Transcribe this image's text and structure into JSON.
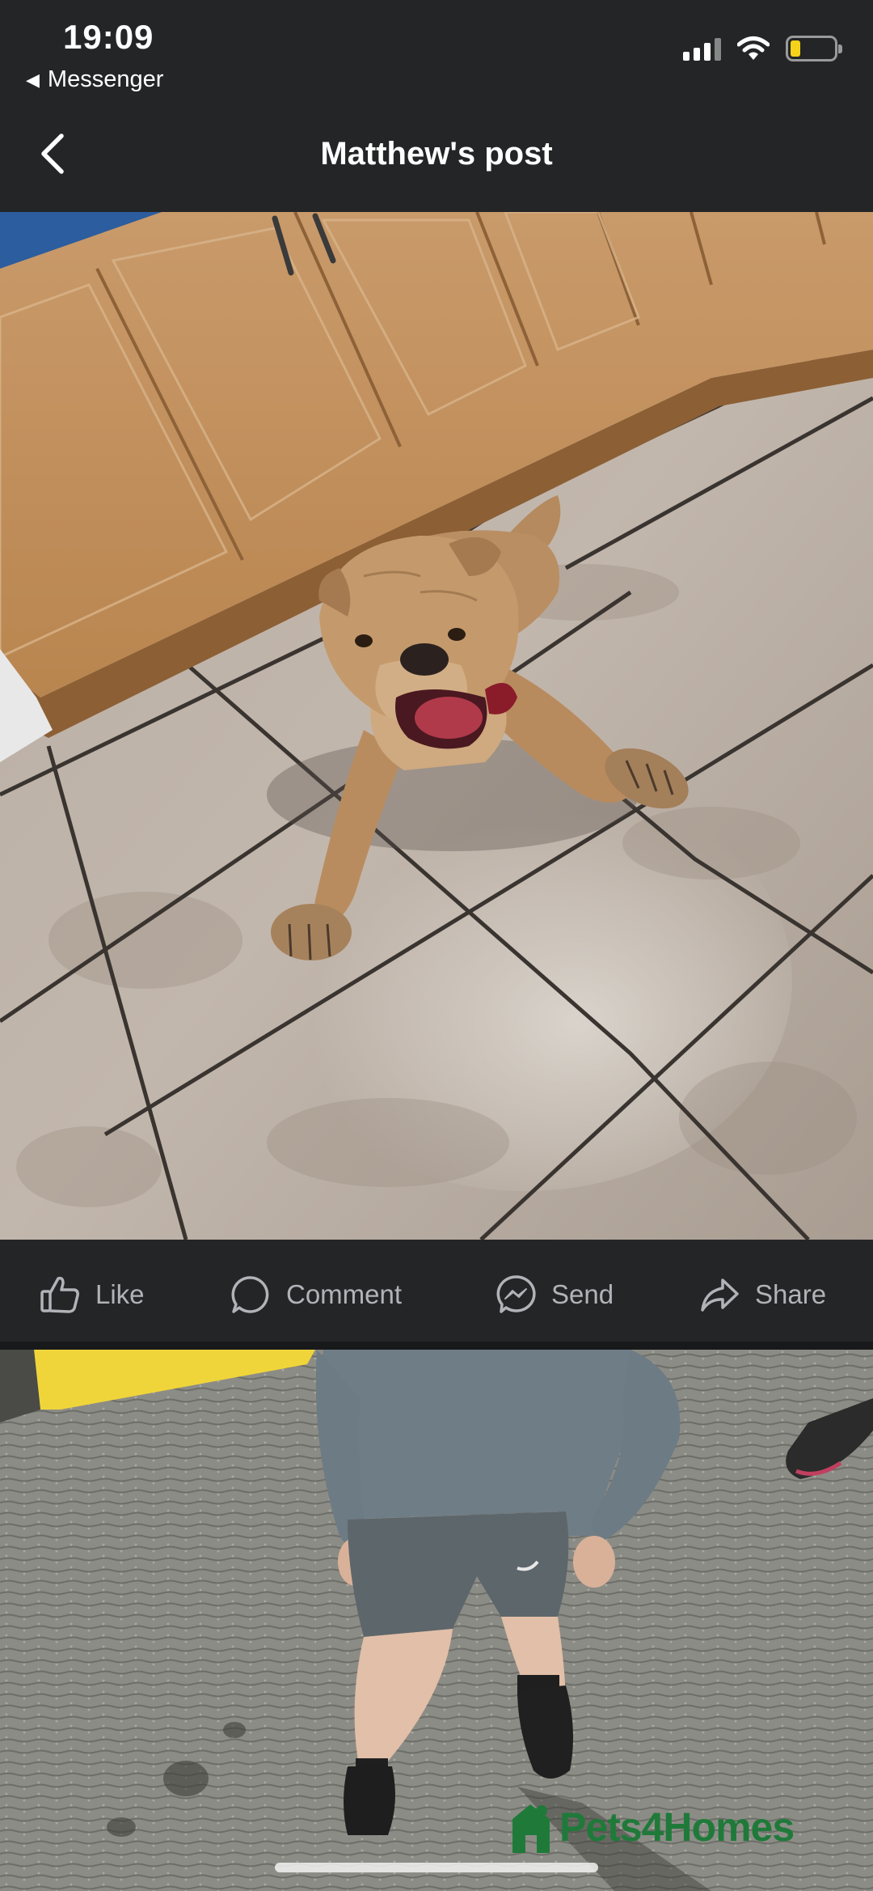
{
  "status_bar": {
    "time": "19:09",
    "back_app_label": "Messenger",
    "battery_level": 0.2,
    "battery_color": "#f7d21a"
  },
  "header": {
    "title": "Matthew's post",
    "back_icon": "chevron-left-icon"
  },
  "photos": [
    {
      "subject": "dog-lying-on-kitchen-floor"
    },
    {
      "subject": "child-standing-on-pavement"
    }
  ],
  "actions": [
    {
      "label": "Like",
      "icon": "thumbs-up-icon"
    },
    {
      "label": "Comment",
      "icon": "comment-bubble-icon"
    },
    {
      "label": "Send",
      "icon": "messenger-icon"
    },
    {
      "label": "Share",
      "icon": "share-arrow-icon"
    }
  ],
  "watermark": {
    "text": "Pets4Homes",
    "color": "#1f7a3a"
  },
  "colors": {
    "background": "#242526",
    "action_text": "#b0b3b8",
    "header_text": "#ffffff"
  }
}
